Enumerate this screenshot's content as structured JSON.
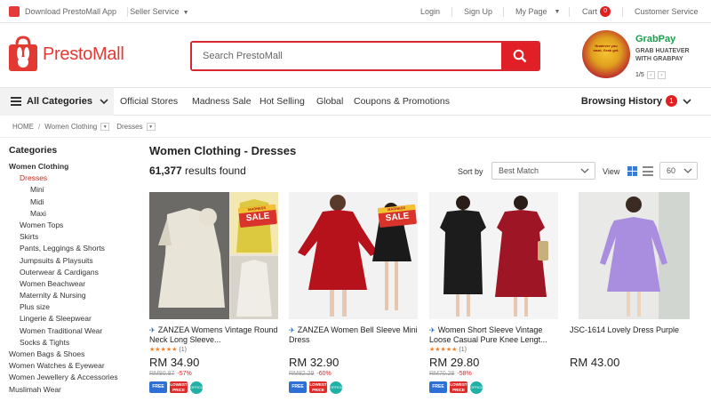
{
  "topbar": {
    "download": "Download PrestoMall App",
    "seller": "Seller Service",
    "login": "Login",
    "signup": "Sign Up",
    "mypage": "My Page",
    "cart": "Cart",
    "cart_count": "0",
    "customer": "Customer Service"
  },
  "header": {
    "logo": "PrestoMall",
    "search_placeholder": "Search PrestoMall",
    "promo": {
      "brand": "GrabPay",
      "line1": "GRAB HUATEVER",
      "line2": "WITH GRABPAY",
      "pager": "1/5",
      "lantern_text": "Huatever you want, Grab got."
    }
  },
  "nav": {
    "all_categories": "All Categories",
    "links": [
      "Official Stores",
      "Madness Sale",
      "Hot Selling",
      "Global",
      "Coupons & Promotions"
    ],
    "browsing_history": "Browsing History",
    "history_count": "1"
  },
  "breadcrumb": {
    "home": "HOME",
    "level1": "Women Clothing",
    "level2": "Dresses"
  },
  "sidebar": {
    "title": "Categories",
    "items": [
      {
        "label": "Women Clothing",
        "level": 1,
        "bold": true
      },
      {
        "label": "Dresses",
        "level": 2,
        "active": true
      },
      {
        "label": "Mini",
        "level": 3
      },
      {
        "label": "Midi",
        "level": 3
      },
      {
        "label": "Maxi",
        "level": 3
      },
      {
        "label": "Women Tops",
        "level": 2
      },
      {
        "label": "Skirts",
        "level": 2
      },
      {
        "label": "Pants, Leggings & Shorts",
        "level": 2
      },
      {
        "label": "Jumpsuits & Playsuits",
        "level": 2
      },
      {
        "label": "Outerwear & Cardigans",
        "level": 2
      },
      {
        "label": "Women Beachwear",
        "level": 2
      },
      {
        "label": "Maternity & Nursing",
        "level": 2
      },
      {
        "label": "Plus size",
        "level": 2
      },
      {
        "label": "Lingerie & Sleepwear",
        "level": 2
      },
      {
        "label": "Women Traditional Wear",
        "level": 2
      },
      {
        "label": "Socks & Tights",
        "level": 2
      },
      {
        "label": "Women Bags & Shoes",
        "level": 1
      },
      {
        "label": "Women Watches & Eyewear",
        "level": 1
      },
      {
        "label": "Women Jewellery & Accessories",
        "level": 1
      },
      {
        "label": "Muslimah Wear",
        "level": 1
      }
    ]
  },
  "main": {
    "title": "Women Clothing - Dresses",
    "results_count": "61,377",
    "results_suffix": " results found",
    "sort_label": "Sort by",
    "sort_value": "Best Match",
    "view_label": "View",
    "per_page": "60"
  },
  "products": [
    {
      "name": "ZANZEA Womens Vintage Round Neck Long Sleeve...",
      "rating": "★★★★★",
      "reviews": "(1)",
      "price": "RM 34.90",
      "old_price": "RM80.87",
      "discount": "-57%",
      "sale_text": "SALE",
      "sale_tag": "MADNESS"
    },
    {
      "name": "ZANZEA Women Bell Sleeve Mini Dress",
      "rating": "",
      "reviews": "",
      "price": "RM 32.90",
      "old_price": "RM82.29",
      "discount": "-60%",
      "sale_text": "SALE",
      "sale_tag": "MADNESS"
    },
    {
      "name": "Women Short Sleeve Vintage Loose Casual Pure Knee Lengt...",
      "rating": "★★★★★",
      "reviews": "(1)",
      "price": "RM 29.80",
      "old_price": "RM70.28",
      "discount": "-58%"
    },
    {
      "name": "JSC-1614 Lovely Dress Purple",
      "rating": "",
      "reviews": "",
      "price": "RM 43.00",
      "old_price": "",
      "discount": ""
    }
  ],
  "badges": {
    "free": "FREE",
    "lowest": "LOWEST PRICE",
    "official": "OFFICIAL"
  }
}
